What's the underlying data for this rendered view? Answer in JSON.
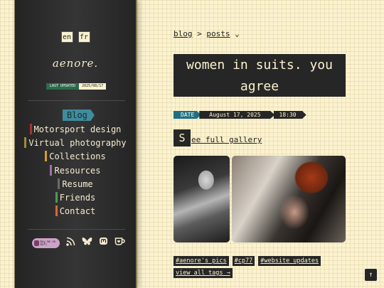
{
  "sidebar": {
    "languages": [
      "en",
      "fr"
    ],
    "site_title": "aenore.",
    "updated_label": "LAST UPDATED",
    "updated_value": "2025/08/17",
    "home": "Blog",
    "nav": [
      {
        "label": "Motorsport design",
        "color": "#b03030"
      },
      {
        "label": "Virtual photography",
        "color": "#9a8c3a"
      },
      {
        "label": "Collections",
        "color": "#d89a3a"
      },
      {
        "label": "Resources",
        "color": "#a070a8"
      },
      {
        "label": "Resume",
        "color": "#6a6a6a"
      },
      {
        "label": "Friends",
        "color": "#4a9a5a"
      },
      {
        "label": "Contact",
        "color": "#d86a30"
      }
    ],
    "kofi_label": "buy me on kofi"
  },
  "main": {
    "breadcrumb": {
      "first": "blog",
      "sep": ">",
      "second": "posts",
      "chevron": "⌄"
    },
    "title": "women in suits. you agree",
    "date_label": "DATE",
    "date_value": "August 17, 2025",
    "time_value": "18:30",
    "gallery_cap": "S",
    "gallery_rest": "ee full gallery",
    "tags": [
      "#aenore's pics",
      "#cp77",
      "#website updates"
    ],
    "all_tags": "view all tags →",
    "back_to_top": "↑"
  }
}
